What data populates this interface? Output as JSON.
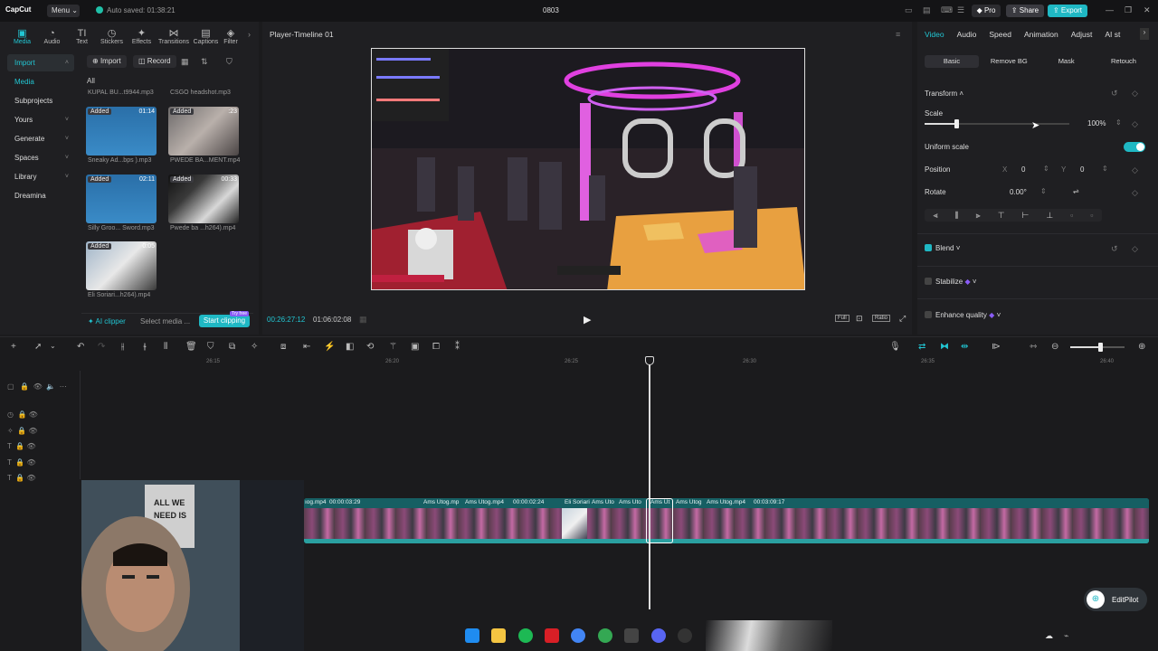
{
  "app": {
    "logo": "CapCut",
    "menu": "Menu",
    "autosave": "Auto saved: 01:38:21",
    "project": "0803",
    "pro": "Pro",
    "share": "Share",
    "export": "Export",
    "window_controls": [
      "—",
      "❐",
      "✕"
    ]
  },
  "media_tabs": [
    {
      "icon": "media-icon",
      "glyph": "▣",
      "label": "Media"
    },
    {
      "icon": "audio-icon",
      "glyph": "◔",
      "label": "Audio"
    },
    {
      "icon": "text-icon",
      "glyph": "TI",
      "label": "Text"
    },
    {
      "icon": "stickers-icon",
      "glyph": "◷",
      "label": "Stickers"
    },
    {
      "icon": "effects-icon",
      "glyph": "✦",
      "label": "Effects"
    },
    {
      "icon": "transitions-icon",
      "glyph": "⋈",
      "label": "Transitions"
    },
    {
      "icon": "captions-icon",
      "glyph": "▤",
      "label": "Captions"
    },
    {
      "icon": "filters-icon",
      "glyph": "◈",
      "label": "Filter"
    }
  ],
  "sidenav": [
    "Import",
    "Media",
    "Subprojects",
    "Yours",
    "Generate",
    "Spaces",
    "Library",
    "Dreamina"
  ],
  "media": {
    "import": "Import",
    "record": "Record",
    "filter_all": "All",
    "top_names": [
      "KUPAL BU...t9944.mp3",
      "CSGO headshot.mp3"
    ],
    "items": [
      {
        "tag": "Added",
        "dur": "01:14",
        "name": "Sneaky Ad...bps ).mp3"
      },
      {
        "tag": "Added",
        "dur": ":23",
        "name": "PWEDE BA...MENT.mp4"
      },
      {
        "tag": "Added",
        "dur": "02:11",
        "name": "Silly Groo... Sword.mp3"
      },
      {
        "tag": "Added",
        "dur": "00:33",
        "name": "Pwede ba ...h264).mp4"
      },
      {
        "tag": "Added",
        "dur": "0:05",
        "name": "Eli Soriari...h264).mp4"
      }
    ],
    "ai_clipper": "AI clipper",
    "select_media": "Select media ...",
    "start_clipping": "Start clipping",
    "try_free": "Try free"
  },
  "player": {
    "title": "Player-Timeline 01",
    "current": "00:26:27:12",
    "duration": "01:06:02:08",
    "full": "Full",
    "ratio": "Ratio"
  },
  "inspector": {
    "tabs": [
      "Video",
      "Audio",
      "Speed",
      "Animation",
      "Adjust",
      "AI st"
    ],
    "subtabs": [
      "Basic",
      "Remove BG",
      "Mask",
      "Retouch"
    ],
    "transform": "Transform",
    "scale": "Scale",
    "scale_value": "100%",
    "scale_level": 0.22,
    "uniform_scale": "Uniform scale",
    "position": "Position",
    "x_label": "X",
    "x": "0",
    "y_label": "Y",
    "y": "0",
    "rotate": "Rotate",
    "rotate_value": "0.00°",
    "blend": "Blend",
    "stabilize": "Stabilize",
    "enhance": "Enhance quality"
  },
  "ruler": [
    "26:15",
    "26:20",
    "26:25",
    "26:30",
    "26:35",
    "26:40"
  ],
  "clips": [
    {
      "label": "ıog.mp4"
    },
    {
      "label": "00:00:03:29"
    },
    {
      "label": "Ams Utog.mp"
    },
    {
      "label": "Ams Utog.mp4"
    },
    {
      "label": "00:00:02:24"
    },
    {
      "label": "Eli Soriari"
    },
    {
      "label": "Ams Uto"
    },
    {
      "label": "Ams Uto"
    },
    {
      "label": "Ams Ut"
    },
    {
      "label": "Ams Utog"
    },
    {
      "label": "Ams Utog.mp4"
    },
    {
      "label": "00:03:09:17"
    }
  ],
  "editpilot": "EditPilot"
}
